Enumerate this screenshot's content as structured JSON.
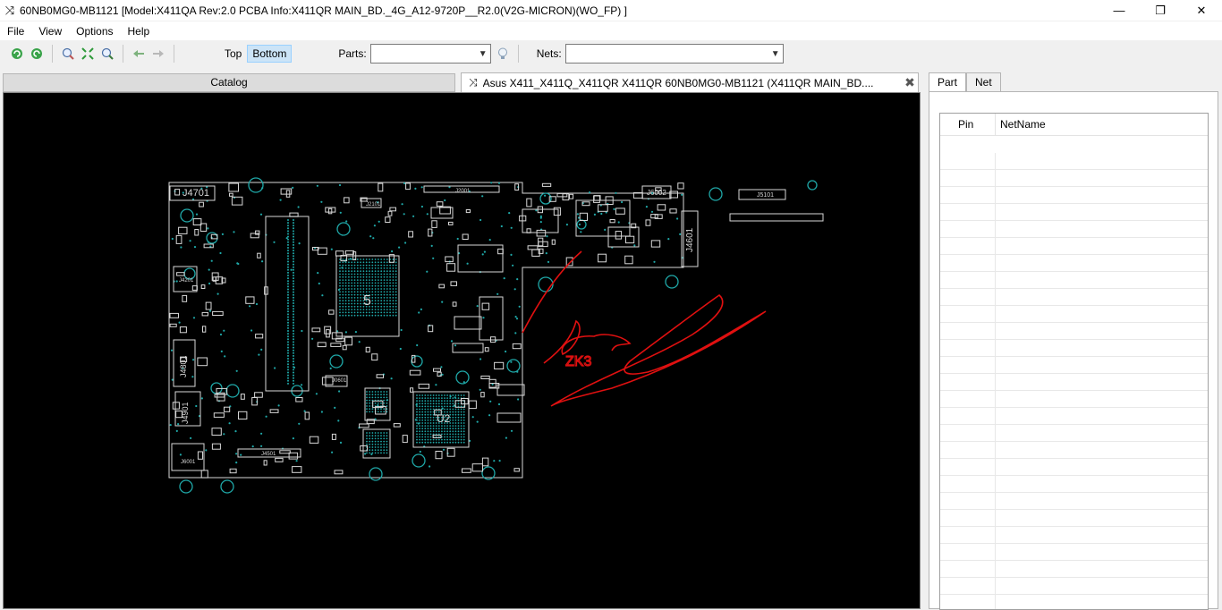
{
  "window": {
    "title": "60NB0MG0-MB1121 [Model:X411QA  Rev:2.0 PCBA Info:X411QR MAIN_BD._4G_A12-9720P__R2.0(V2G-MICRON)(WO_FP) ]",
    "app_icon": "⤨",
    "minimize": "—",
    "maximize": "❐",
    "close": "✕"
  },
  "menu": [
    "File",
    "View",
    "Options",
    "Help"
  ],
  "toolbar": {
    "icons": [
      "rotate-left-icon",
      "rotate-right-icon",
      "zoom-in-icon",
      "fit-icon",
      "zoom-out-icon",
      "back-arrow-icon",
      "forward-arrow-icon"
    ],
    "top_label": "Top",
    "bottom_label": "Bottom",
    "parts_label": "Parts:",
    "parts_value": "",
    "nets_label": "Nets:",
    "nets_value": ""
  },
  "tabs": {
    "catalog": "Catalog",
    "board": "Asus X411_X411Q_X411QR X411QR 60NB0MG0-MB1121 (X411QR MAIN_BD...."
  },
  "board": {
    "labels": [
      "J4701",
      "J2101",
      "J2001",
      "J6002",
      "J5101",
      "J4601",
      "J4201",
      "J4801",
      "J4901",
      "J6001",
      "J4501",
      "J0601",
      "U2",
      "5"
    ],
    "annotation_text": "ZK3"
  },
  "right_panel": {
    "tabs": [
      "Part",
      "Net"
    ],
    "columns": [
      "Pin",
      "NetName"
    ],
    "row_count": 27
  },
  "colors": {
    "board_bg": "#000000",
    "part_outline": "#d8d8d8",
    "pad_teal": "#1fa8a8",
    "annotation_red": "#e01010",
    "active_button": "#cce4f7"
  }
}
